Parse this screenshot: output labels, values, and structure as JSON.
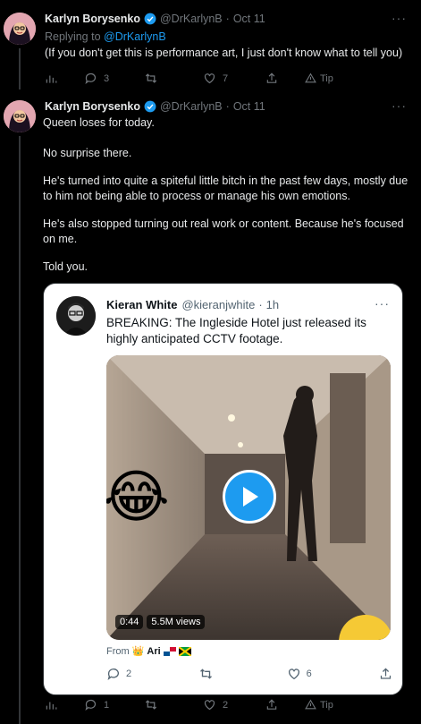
{
  "tweet1": {
    "author_name": "Karlyn Borysenko",
    "handle": "@DrKarlynB",
    "separator": "·",
    "date": "Oct 11",
    "more": "···",
    "replying_prefix": "Replying to",
    "replying_to": "@DrKarlynB",
    "text": "(If you don't get this is performance art, I just don't know what to tell you)",
    "replies": "3",
    "retweets": "",
    "likes": "7",
    "tip_label": "Tip"
  },
  "tweet2": {
    "author_name": "Karlyn Borysenko",
    "handle": "@DrKarlynB",
    "separator": "·",
    "date": "Oct 11",
    "more": "···",
    "paragraphs": [
      "Queen loses for today.",
      "No surprise there.",
      "He's turned into quite a spiteful little bitch in the past few days, mostly due to him not being able to process or manage his own emotions.",
      "He's also stopped turning out real work or content. Because he's focused on me.",
      "Told you."
    ],
    "replies": "1",
    "retweets": "",
    "likes": "2",
    "tip_label": "Tip"
  },
  "quote": {
    "author_name": "Kieran White",
    "handle": "@kieranjwhite",
    "separator": "·",
    "date": "1h",
    "more": "···",
    "text": "BREAKING: The Ingleside Hotel just released its highly anticipated CCTV footage.",
    "video_duration": "0:44",
    "video_views": "5.5M views",
    "from_prefix": "From",
    "from_name": "Ari",
    "replies": "2",
    "retweets": "",
    "likes": "6"
  },
  "colors": {
    "background": "#000000",
    "text": "#e7e9ea",
    "secondary": "#71767b",
    "accent": "#1d9bf0",
    "card": "#ffffff"
  },
  "icons": [
    "analytics-icon",
    "reply-icon",
    "retweet-icon",
    "like-icon",
    "share-icon",
    "tip-icon",
    "verified-badge-icon",
    "play-icon",
    "laughing-emoji-icon",
    "crown-emoji-icon",
    "panama-flag-icon",
    "jamaica-flag-icon"
  ]
}
